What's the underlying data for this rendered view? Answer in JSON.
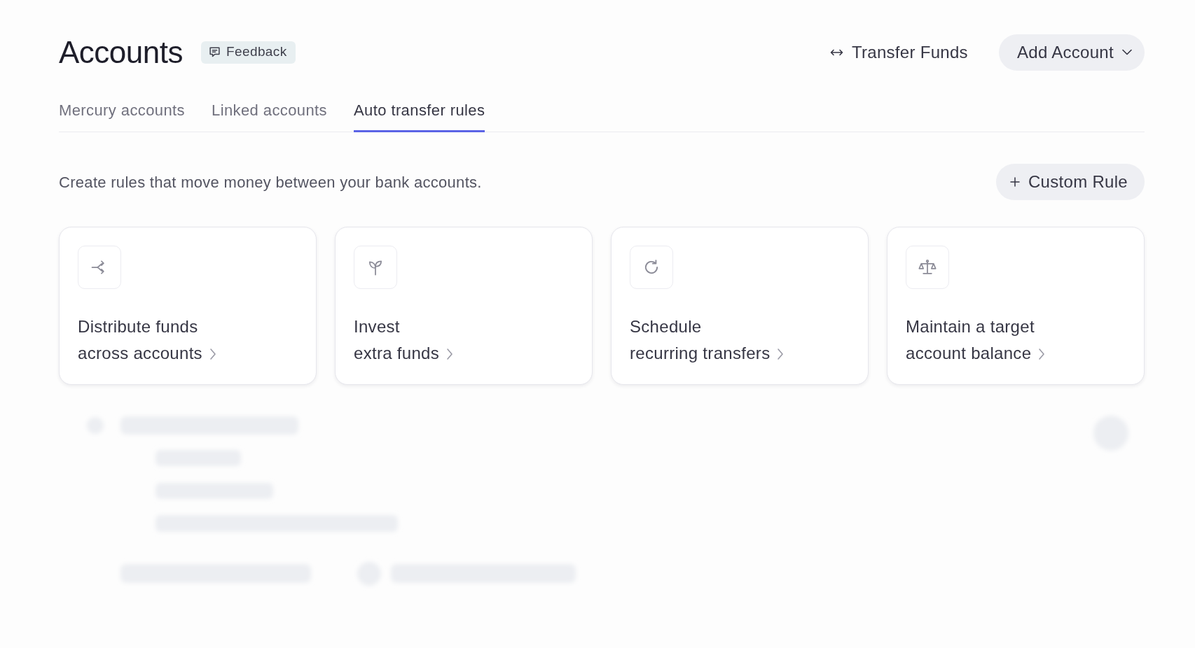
{
  "header": {
    "title": "Accounts",
    "feedback_button": {
      "label": "Feedback"
    },
    "transfer_button": {
      "label": "Transfer Funds"
    },
    "add_account_button": {
      "label": "Add Account"
    }
  },
  "tabs": [
    {
      "label": "Mercury accounts",
      "selected": false
    },
    {
      "label": "Linked accounts",
      "selected": false
    },
    {
      "label": "Auto transfer rules",
      "selected": true
    }
  ],
  "description": "Create rules that move money between your bank accounts.",
  "custom_rule_button": {
    "label": "Custom Rule"
  },
  "rule_cards": [
    {
      "lines": [
        "Distribute funds",
        "across accounts"
      ]
    },
    {
      "lines": [
        "Invest",
        "extra funds"
      ]
    },
    {
      "lines": [
        "Schedule",
        "recurring transfers"
      ]
    },
    {
      "lines": [
        "Maintain a target",
        "account balance"
      ]
    }
  ]
}
